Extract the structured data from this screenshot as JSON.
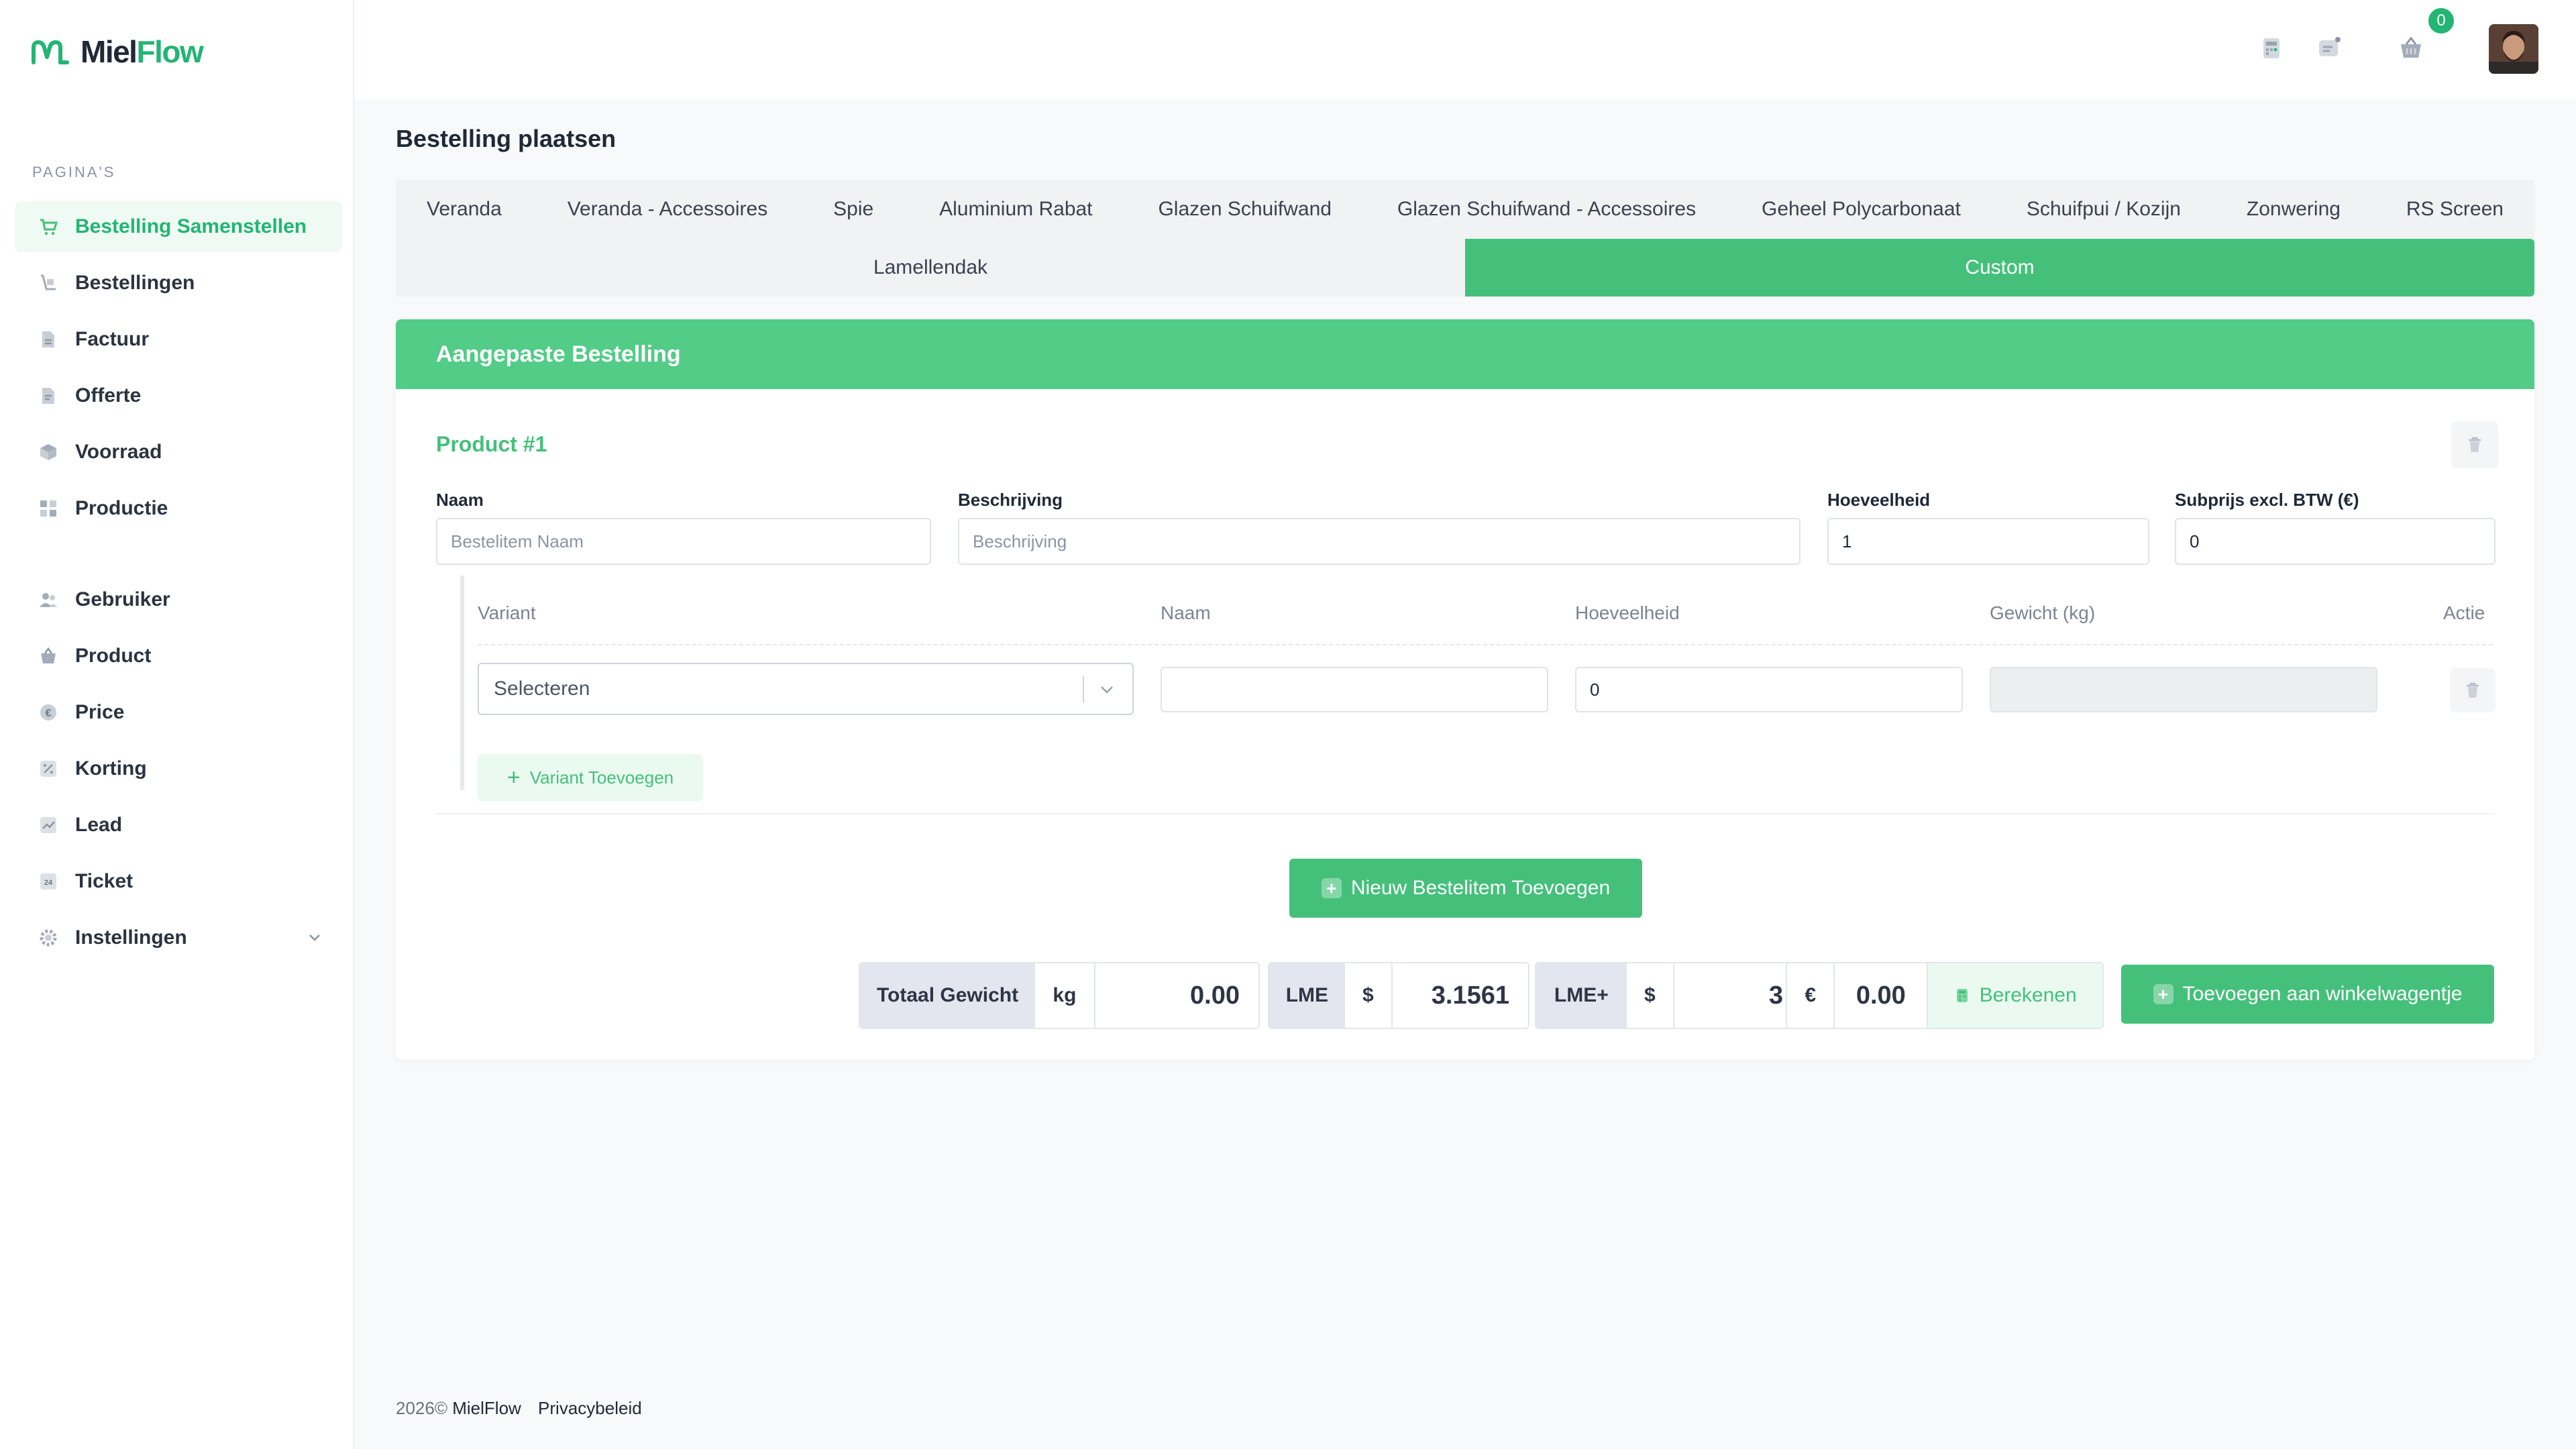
{
  "brand": {
    "name_part1": "Miel",
    "name_part2": "Flow"
  },
  "colors": {
    "accent": "#45c07b",
    "accent_light": "#eafaf1",
    "header_green": "#52cc87"
  },
  "sidebar": {
    "caption": "PAGINA'S",
    "items": [
      {
        "label": "Bestelling Samenstellen",
        "icon": "cart-icon",
        "active": true
      },
      {
        "label": "Bestellingen",
        "icon": "orders-icon"
      },
      {
        "label": "Factuur",
        "icon": "invoice-icon"
      },
      {
        "label": "Offerte",
        "icon": "quote-icon"
      },
      {
        "label": "Voorraad",
        "icon": "box-icon"
      },
      {
        "label": "Productie",
        "icon": "grid-icon"
      },
      {
        "label": "Gebruiker",
        "icon": "users-icon"
      },
      {
        "label": "Product",
        "icon": "basket-icon"
      },
      {
        "label": "Price",
        "icon": "euro-icon"
      },
      {
        "label": "Korting",
        "icon": "percent-icon"
      },
      {
        "label": "Lead",
        "icon": "chart-icon"
      },
      {
        "label": "Ticket",
        "icon": "ticket-24-icon"
      },
      {
        "label": "Instellingen",
        "icon": "settings-icon",
        "has_chevron": true
      }
    ]
  },
  "topbar": {
    "cart_count": "0"
  },
  "page": {
    "title": "Bestelling plaatsen",
    "tabs": [
      "Veranda",
      "Veranda - Accessoires",
      "Spie",
      "Aluminium Rabat",
      "Glazen Schuifwand",
      "Glazen Schuifwand - Accessoires",
      "Geheel Polycarbonaat",
      "Schuifpui / Kozijn",
      "Zonwering",
      "RS Screen"
    ],
    "tabs2": [
      {
        "label": "Lamellendak",
        "active": false
      },
      {
        "label": "Custom",
        "active": true
      }
    ]
  },
  "card": {
    "header": "Aangepaste Bestelling",
    "product_title": "Product #1",
    "fields": {
      "naam": {
        "label": "Naam",
        "placeholder": "Bestelitem Naam",
        "value": ""
      },
      "beschrijving": {
        "label": "Beschrijving",
        "placeholder": "Beschrijving",
        "value": ""
      },
      "hoeveelheid": {
        "label": "Hoeveelheid",
        "value": "1"
      },
      "subprijs": {
        "label": "Subprijs excl. BTW (€)",
        "value": "0"
      }
    },
    "variant_table": {
      "headers": [
        "Variant",
        "Naam",
        "Hoeveelheid",
        "Gewicht (kg)",
        "Actie"
      ],
      "row": {
        "select_value": "Selecteren",
        "naam": "",
        "hoeveelheid": "0",
        "gewicht": ""
      },
      "add_label": "Variant Toevoegen"
    },
    "new_item_label": "Nieuw Bestelitem Toevoegen",
    "totals": {
      "weight_label": "Totaal Gewicht",
      "weight_unit": "kg",
      "weight_value": "0.00",
      "lme_label": "LME",
      "lme_currency": "$",
      "lme_value": "3.1561",
      "lmeplus_label": "LME+",
      "lmeplus_currency": "$",
      "lmeplus_value": "3",
      "price_currency": "€",
      "price_value": "0.00",
      "calculate_label": "Berekenen"
    },
    "add_to_cart_label": "Toevoegen aan winkelwagentje"
  },
  "footer": {
    "year_text": "2026©",
    "brand": "MielFlow",
    "privacy": "Privacybeleid"
  }
}
